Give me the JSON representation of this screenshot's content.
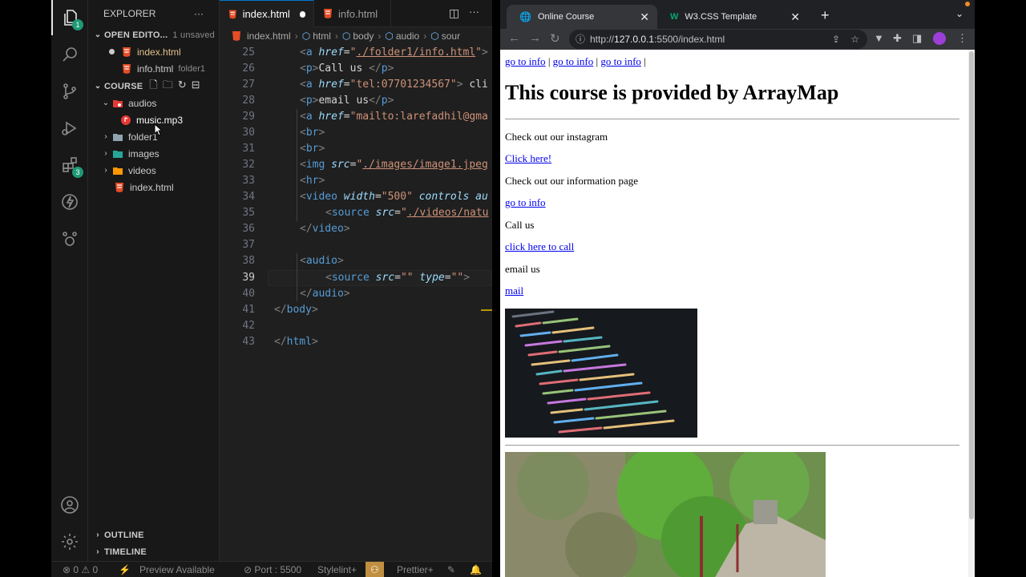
{
  "vscode": {
    "activity_badges": {
      "explorer": "1",
      "extensions": "3"
    },
    "sidebar": {
      "title": "EXPLORER",
      "more": "···",
      "open_editors": {
        "label": "OPEN EDITO...",
        "status": "1 unsaved"
      },
      "open_files": [
        {
          "name": "index.html",
          "folder": ""
        },
        {
          "name": "info.html",
          "folder": "folder1"
        }
      ],
      "project": "COURSE",
      "tree": [
        {
          "name": "audios"
        },
        {
          "name": "music.mp3"
        },
        {
          "name": "folder1"
        },
        {
          "name": "images"
        },
        {
          "name": "videos"
        },
        {
          "name": "index.html"
        }
      ],
      "outline": "OUTLINE",
      "timeline": "TIMELINE"
    },
    "tabs": [
      {
        "label": "index.html"
      },
      {
        "label": "info.html"
      }
    ],
    "breadcrumb": [
      "index.html",
      "html",
      "body",
      "audio",
      "sour"
    ],
    "line_numbers": [
      "25",
      "26",
      "27",
      "28",
      "29",
      "30",
      "31",
      "32",
      "33",
      "34",
      "35",
      "36",
      "37",
      "38",
      "39",
      "40",
      "41",
      "42",
      "43"
    ],
    "current_line": "39",
    "code": {
      "l25": [
        "<",
        "a",
        " href",
        "=",
        "\"",
        "./folder1/info.html",
        "\"",
        ">"
      ],
      "l26": [
        "<",
        "p",
        ">",
        "Call us ",
        "</",
        "p",
        ">"
      ],
      "l27": [
        "<",
        "a",
        " href",
        "=",
        "\"tel:07701234567\"",
        ">",
        " cli"
      ],
      "l28": [
        "<",
        "p",
        ">",
        "email us",
        "</",
        "p",
        ">"
      ],
      "l29": [
        "<",
        "a",
        " href",
        "=",
        "\"mailto:larefadhil@gma"
      ],
      "l30": [
        "<",
        "br",
        ">"
      ],
      "l31": [
        "<",
        "br",
        ">"
      ],
      "l32": [
        "<",
        "img",
        " src",
        "=",
        "\"",
        "./images/image1.jpeg"
      ],
      "l33": [
        "<",
        "hr",
        ">"
      ],
      "l34": [
        "<",
        "video",
        " width",
        "=",
        "\"500\"",
        " controls",
        " au"
      ],
      "l35": [
        "<",
        "source",
        " src",
        "=",
        "\"",
        "./videos/natu"
      ],
      "l36": [
        "</",
        "video",
        ">"
      ],
      "l38": [
        "<",
        "audio",
        ">"
      ],
      "l39": [
        "<",
        "source",
        " src",
        "=",
        "\"\"",
        " type",
        "=",
        "\"\"",
        ">"
      ],
      "l40": [
        "</",
        "audio",
        ">"
      ],
      "l41": [
        "</",
        "body",
        ">"
      ],
      "l43": [
        "</",
        "html",
        ">"
      ]
    },
    "status": {
      "errors": "0",
      "warnings": "0",
      "preview": "Preview Available",
      "port": "Port : 5500",
      "stylelint": "Stylelint+",
      "prettier": "Prettier+"
    }
  },
  "browser": {
    "tabs": [
      {
        "label": "Online Course"
      },
      {
        "label": "W3.CSS Template"
      }
    ],
    "url_prefix": "http://",
    "url_host": "127.0.0.1",
    "url_rest": ":5500/index.html",
    "page": {
      "top_links": [
        "go to info",
        "go to info",
        "go to info"
      ],
      "separator": "|",
      "heading": "This course is provided by ArrayMap",
      "p1": "Check out our instagram",
      "link1": "Click here!",
      "p2": "Check out our information page",
      "link2": "go to info",
      "p3": "Call us",
      "link3": "click here to call",
      "p4": "email us",
      "link4": "mail"
    }
  }
}
